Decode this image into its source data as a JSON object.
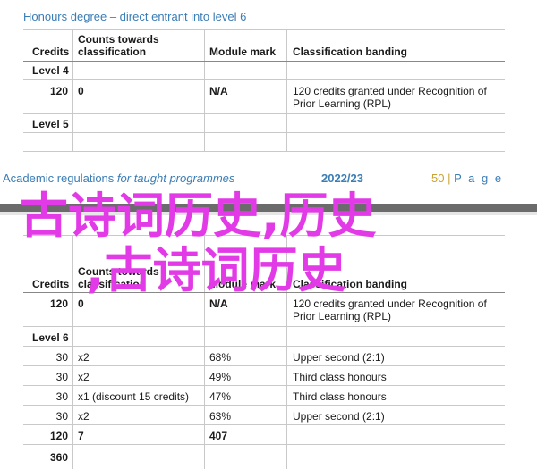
{
  "page1": {
    "section_title": "Honours degree – direct entrant into level 6",
    "headers": {
      "credits": "Credits",
      "counts": "Counts towards classification",
      "module_mark": "Module mark",
      "banding": "Classification banding"
    },
    "level4": "Level 4",
    "row1": {
      "credits": "120",
      "counts": "0",
      "mark": "N/A",
      "banding": "120 credits granted under Recognition of Prior Learning (RPL)"
    },
    "level5": "Level 5"
  },
  "footer": {
    "title_main": "Academic regulations",
    "title_sub": " for taught programmes",
    "year": "2022/23",
    "page_num": "50",
    "page_sep": "|",
    "page_word": "P a g e"
  },
  "page2": {
    "headers": {
      "credits": "Credits",
      "counts": "Counts towards classification",
      "module_mark": "Module mark",
      "banding": "Classification banding"
    },
    "row1": {
      "credits": "120",
      "counts": "0",
      "mark": "N/A",
      "banding": "120 credits granted under Recognition of Prior Learning (RPL)"
    },
    "level6": "Level 6",
    "rows": [
      {
        "credits": "30",
        "counts": "x2",
        "mark": "68%",
        "banding": "Upper second (2:1)"
      },
      {
        "credits": "30",
        "counts": "x2",
        "mark": "49%",
        "banding": "Third class honours"
      },
      {
        "credits": "30",
        "counts": "x1 (discount 15 credits)",
        "mark": "47%",
        "banding": "Third class honours"
      },
      {
        "credits": "30",
        "counts": "x2",
        "mark": "63%",
        "banding": "Upper second (2:1)"
      }
    ],
    "total": {
      "credits": "120",
      "counts": "7",
      "mark": "407"
    },
    "grand_total": {
      "credits": "360"
    }
  },
  "overlay": {
    "line1": "古诗词历史,历史",
    "line2": ",古诗词历史"
  },
  "colors": {
    "accent_blue": "#3b7db5",
    "overlay_magenta": "#e23ae6",
    "gold": "#c8a232"
  }
}
